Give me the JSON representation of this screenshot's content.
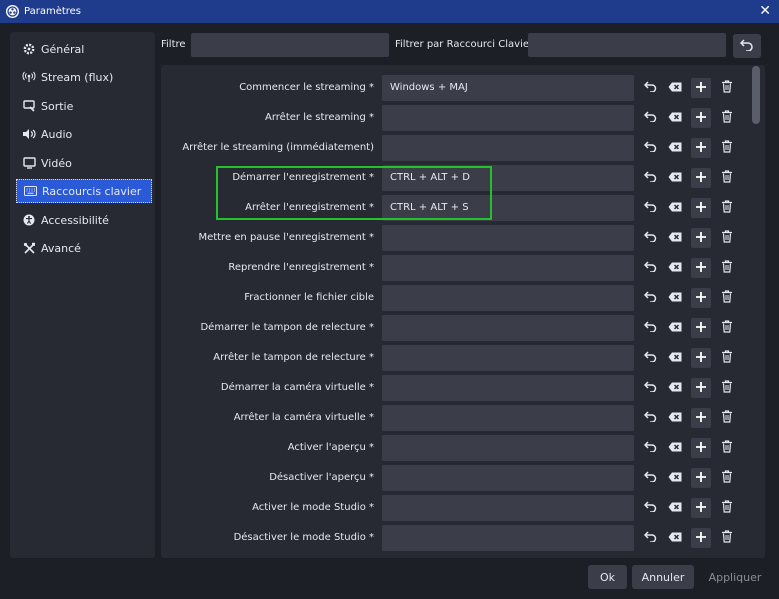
{
  "window": {
    "title": "Paramètres",
    "close_glyph": "✕"
  },
  "sidebar": {
    "items": [
      {
        "label": "Général",
        "icon": "gear-icon"
      },
      {
        "label": "Stream (flux)",
        "icon": "broadcast-icon"
      },
      {
        "label": "Sortie",
        "icon": "output-icon"
      },
      {
        "label": "Audio",
        "icon": "speaker-icon"
      },
      {
        "label": "Vidéo",
        "icon": "monitor-icon"
      },
      {
        "label": "Raccourcis clavier",
        "icon": "keyboard-icon",
        "active": true
      },
      {
        "label": "Accessibilité",
        "icon": "accessibility-icon"
      },
      {
        "label": "Avancé",
        "icon": "tools-icon"
      }
    ]
  },
  "filters": {
    "filter_label": "Filtre",
    "filter_value": "",
    "hotkey_filter_label": "Filtrer par Raccourci Clavier",
    "hotkey_filter_value": ""
  },
  "hotkeys": [
    {
      "label": "Commencer le streaming *",
      "key": "Windows + MAJ"
    },
    {
      "label": "Arrêter le streaming *",
      "key": ""
    },
    {
      "label": "Arrêter le streaming (immédiatement)",
      "key": ""
    },
    {
      "label": "Démarrer l'enregistrement *",
      "key": "CTRL + ALT + D"
    },
    {
      "label": "Arrêter l'enregistrement *",
      "key": "CTRL + ALT + S"
    },
    {
      "label": "Mettre en pause l'enregistrement *",
      "key": ""
    },
    {
      "label": "Reprendre l'enregistrement *",
      "key": ""
    },
    {
      "label": "Fractionner le fichier cible",
      "key": ""
    },
    {
      "label": "Démarrer le tampon de relecture *",
      "key": ""
    },
    {
      "label": "Arrêter le tampon de relecture *",
      "key": ""
    },
    {
      "label": "Démarrer la caméra virtuelle *",
      "key": ""
    },
    {
      "label": "Arrêter la caméra virtuelle *",
      "key": ""
    },
    {
      "label": "Activer l'aperçu *",
      "key": ""
    },
    {
      "label": "Désactiver l'aperçu *",
      "key": ""
    },
    {
      "label": "Activer le mode Studio *",
      "key": ""
    },
    {
      "label": "Désactiver le mode Studio *",
      "key": ""
    }
  ],
  "footer": {
    "ok": "Ok",
    "cancel": "Annuler",
    "apply": "Appliquer"
  },
  "colors": {
    "accent": "#2b5ad8",
    "titlebar": "#1f3c8c",
    "highlight": "#23c12b"
  }
}
